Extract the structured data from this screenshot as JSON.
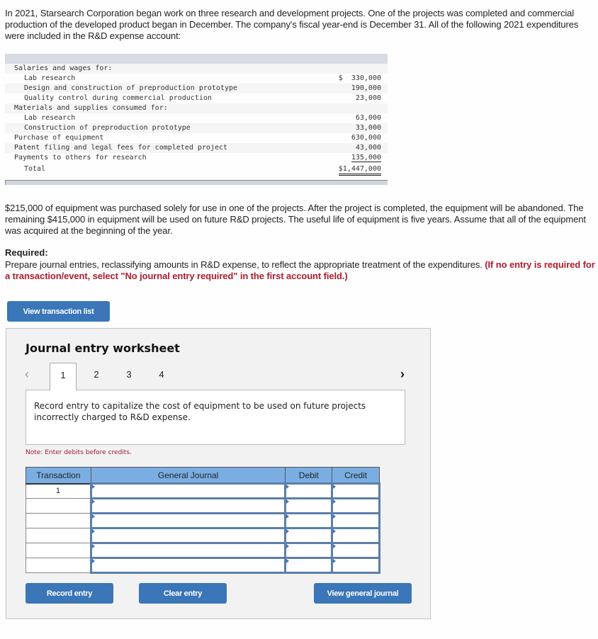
{
  "intro": "In 2021, Starsearch Corporation began work on three research and development projects. One of the projects was completed and commercial production of the developed product began in December. The company's fiscal year-end is December 31. All of the following 2021 expenditures were included in the R&D expense account:",
  "expenditures": {
    "rows": [
      {
        "label": "Salaries and wages for:",
        "amount": ""
      },
      {
        "label": "Lab research",
        "amount": "$  330,000"
      },
      {
        "label": "Design and construction of preproduction prototype",
        "amount": "190,000"
      },
      {
        "label": "Quality control during commercial production",
        "amount": "23,000"
      },
      {
        "label": "Materials and supplies consumed for:",
        "amount": ""
      },
      {
        "label": "Lab research",
        "amount": "63,000"
      },
      {
        "label": "Construction of preproduction prototype",
        "amount": "33,000"
      },
      {
        "label": "Purchase of equipment",
        "amount": "630,000"
      },
      {
        "label": "Patent filing and legal fees for completed project",
        "amount": "43,000"
      },
      {
        "label": "Payments to others for research",
        "amount": "135,000"
      }
    ],
    "total_label": "Total",
    "total_amount": "$1,447,000"
  },
  "paragraph2": "$215,000 of equipment was purchased solely for use in one of the projects. After the project is completed, the equipment will be abandoned. The remaining $415,000 in equipment will be used on future R&D projects. The useful life of equipment is five years. Assume that all of the equipment was acquired at the beginning of the year.",
  "required": {
    "title": "Required:",
    "text": "Prepare journal entries, reclassifying amounts in R&D expense, to reflect the appropriate treatment of the expenditures. ",
    "instruction": "(If no entry is required for a transaction/event, select \"No journal entry required\" in the first account field.)"
  },
  "buttons": {
    "view_transaction_list": "View transaction list",
    "record_entry": "Record entry",
    "clear_entry": "Clear entry",
    "view_general_journal": "View general journal"
  },
  "worksheet": {
    "title": "Journal entry worksheet",
    "tabs": [
      "1",
      "2",
      "3",
      "4"
    ],
    "active_tab": "1",
    "prev_icon": "‹",
    "next_icon": "›",
    "description": "Record entry to capitalize the cost of equipment to be used on future projects incorrectly charged to R&D expense.",
    "note": "Note: Enter debits before credits.",
    "table": {
      "headers": [
        "Transaction",
        "General Journal",
        "Debit",
        "Credit"
      ],
      "rows": [
        {
          "transaction": "1",
          "account": "",
          "debit": "",
          "credit": ""
        },
        {
          "transaction": "",
          "account": "",
          "debit": "",
          "credit": ""
        },
        {
          "transaction": "",
          "account": "",
          "debit": "",
          "credit": ""
        },
        {
          "transaction": "",
          "account": "",
          "debit": "",
          "credit": ""
        },
        {
          "transaction": "",
          "account": "",
          "debit": "",
          "credit": ""
        },
        {
          "transaction": "",
          "account": "",
          "debit": "",
          "credit": ""
        }
      ]
    }
  },
  "colors": {
    "button_blue": "#3a76b8",
    "header_blue": "#7aaee3",
    "required_red": "#b01c2e"
  }
}
